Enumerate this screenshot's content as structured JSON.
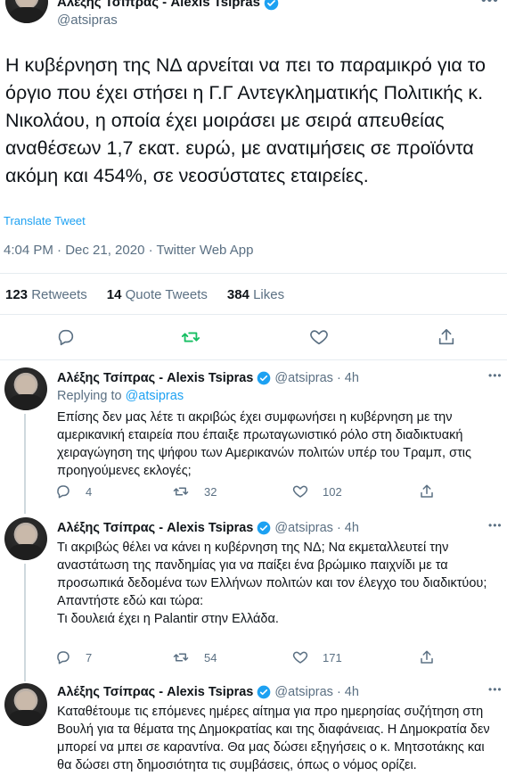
{
  "main_tweet": {
    "author_name": "Αλέξης Τσίπρας - Alexis Tsipras",
    "handle": "@atsipras",
    "text": "Η κυβέρνηση της ΝΔ αρνείται να πει το παραμικρό για το όργιο που έχει στήσει η Γ.Γ Αντεγκληματικής Πολιτικής κ. Νικολάου, η οποία έχει μοιράσει με σειρά απευθείας αναθέσεων 1,7 εκατ. ευρώ, με ανατιμήσεις σε προϊόντα ακόμη και 454%, σε νεοσύστατες εταιρείες.",
    "translate_label": "Translate Tweet",
    "meta": "4:04 PM · Dec 21, 2020 · Twitter Web App",
    "retweets_count": "123",
    "retweets_label": "Retweets",
    "quotes_count": "14",
    "quotes_label": "Quote Tweets",
    "likes_count": "384",
    "likes_label": "Likes"
  },
  "replies": [
    {
      "author_name": "Αλέξης Τσίπρας - Alexis Tsipras",
      "handle": "@atsipras",
      "time": "· 4h",
      "replying_label": "Replying to",
      "replying_handle": "@atsipras",
      "text": "Επίσης δεν μας λέτε τι ακριβώς έχει συμφωνήσει η κυβέρνηση με την αμερικανική εταιρεία που έπαιξε πρωταγωνιστικό ρόλο στη διαδικτυακή χειραγώγηση της ψήφου των Αμερικανών πολιτών υπέρ του Τραμπ, στις προηγούμενες εκλογές;",
      "replies": "4",
      "retweets": "32",
      "likes": "102"
    },
    {
      "author_name": "Αλέξης Τσίπρας - Alexis Tsipras",
      "handle": "@atsipras",
      "time": "· 4h",
      "text": "Τι ακριβώς θέλει να κάνει η κυβέρνηση της ΝΔ; Να εκμεταλλευτεί την αναστάτωση της πανδημίας για να παίξει ένα βρώμικο παιχνίδι με τα προσωπικά δεδομένα των Ελλήνων πολιτών και τον έλεγχο του διαδικτύου;\nΑπαντήστε εδώ και τώρα:\nΤι δουλειά έχει η Palantir στην Ελλάδα.",
      "replies": "7",
      "retweets": "54",
      "likes": "171"
    },
    {
      "author_name": "Αλέξης Τσίπρας - Alexis Tsipras",
      "handle": "@atsipras",
      "time": "· 4h",
      "text": "Καταθέτουμε τις επόμενες ημέρες αίτημα για προ ημερησίας συζήτηση στη Βουλή για τα θέματα της Δημοκρατίας και της διαφάνειας. Η Δημοκρατία δεν μπορεί να μπει σε καραντίνα. Θα μας δώσει εξηγήσεις ο κ. Μητσοτάκης και θα δώσει στη δημοσιότητα τις συμβάσεις, όπως ο νόμος ορίζει."
    }
  ],
  "icons": {
    "reply": "reply-icon",
    "retweet": "retweet-icon",
    "like": "heart-icon",
    "share": "share-icon",
    "more": "more-icon",
    "verified": "verified-badge-icon"
  },
  "colors": {
    "link": "#1da1f2",
    "retweet_green": "#17bf63",
    "muted": "#5b7083",
    "text": "#0f1419",
    "divider": "#e6ecf0"
  }
}
